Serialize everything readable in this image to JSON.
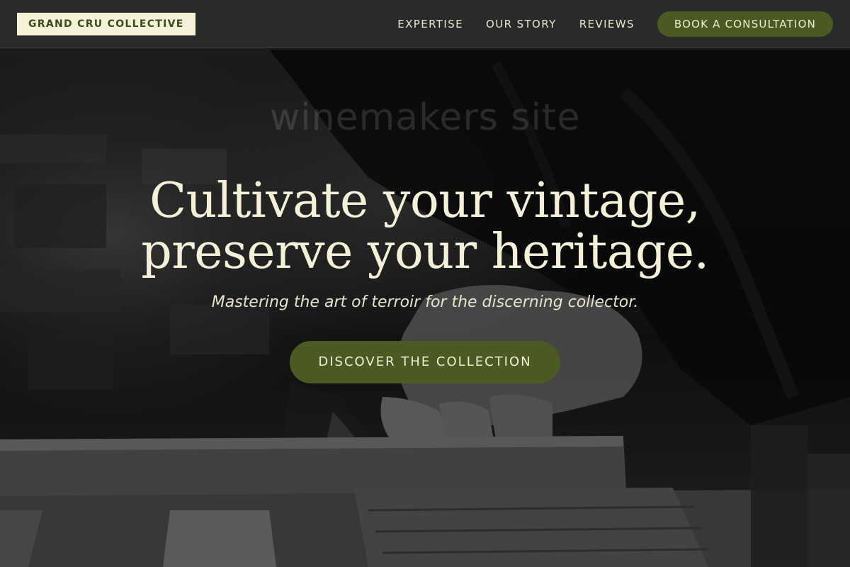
{
  "header": {
    "logo": "GRAND CRU COLLECTIVE",
    "nav": [
      {
        "label": "EXPERTISE"
      },
      {
        "label": "OUR STORY"
      },
      {
        "label": "REVIEWS"
      }
    ],
    "cta_label": "BOOK A CONSULTATION"
  },
  "hero": {
    "headline_line1": "Cultivate your vintage,",
    "headline_line2": "preserve your heritage.",
    "watermark": "winemakers site",
    "subheadline": "Mastering the art of terroir for the discerning collector.",
    "button_label": "DISCOVER THE COLLECTION"
  },
  "colors": {
    "accent": "#4b5a22",
    "cream": "#f4f1d8",
    "header_bg": "#2a2a2a"
  }
}
